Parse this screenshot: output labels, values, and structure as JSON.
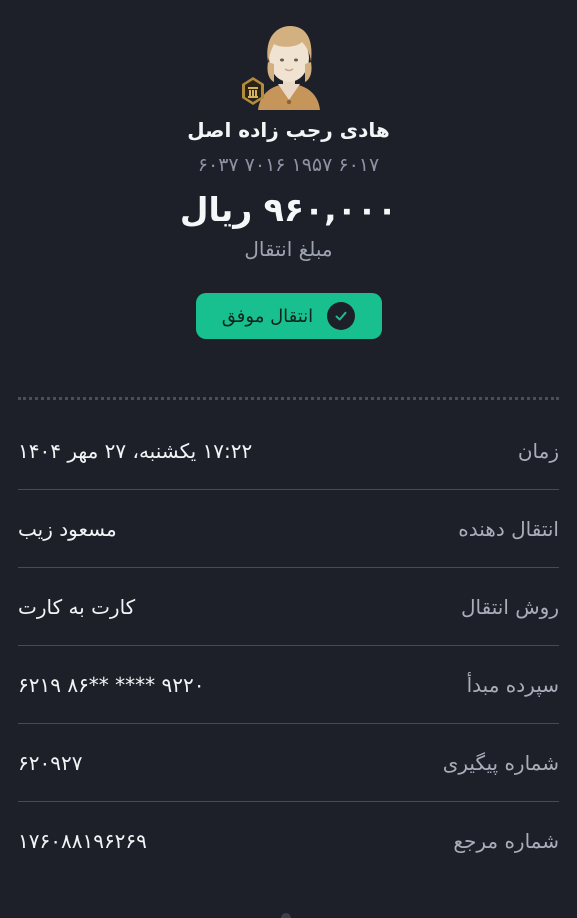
{
  "recipient": {
    "name": "هادی رجب زاده اصل",
    "card_number": "۶۰۳۷  ۷۰۱۶  ۱۹۵۷  ۶۰۱۷"
  },
  "transfer": {
    "amount": "۹۶۰,۰۰۰ ریال",
    "amount_label": "مبلغ انتقال",
    "status_label": "انتقال موفق"
  },
  "details": [
    {
      "label": "زمان",
      "value": "۱۷:۲۲ یکشنبه، ۲۷ مهر ۱۴۰۴"
    },
    {
      "label": "انتقال دهنده",
      "value": "مسعود زیب"
    },
    {
      "label": "روش انتقال",
      "value": "کارت به کارت"
    },
    {
      "label": "سپرده مبدأ",
      "value": "۶۲۱۹  ۸۶** **** ۹۲۲۰"
    },
    {
      "label": "شماره پیگیری",
      "value": "۶۲۰۹۲۷"
    },
    {
      "label": "شماره مرجع",
      "value": "۱۷۶۰۸۸۱۹۶۲۶۹"
    }
  ],
  "colors": {
    "background": "#1d2029",
    "success": "#17c08e",
    "muted_text": "#a9adb9",
    "divider": "#474b56"
  },
  "icons": [
    "avatar-icon",
    "bank-emblem-icon",
    "check-circle-icon"
  ]
}
